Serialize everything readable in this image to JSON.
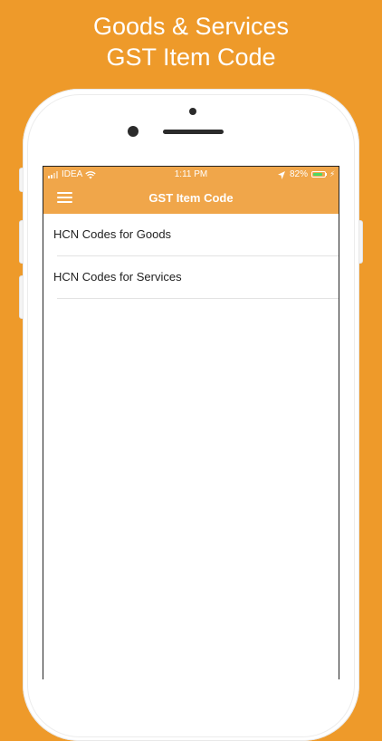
{
  "promo": {
    "line1": "Goods & Services",
    "line2": "GST Item Code"
  },
  "status_bar": {
    "carrier": "IDEA",
    "time": "1:11 PM",
    "battery_percent": "82%",
    "battery_level": 0.82
  },
  "nav": {
    "title": "GST Item Code",
    "menu_icon": "hamburger-menu-icon"
  },
  "items": [
    {
      "label": "HCN Codes for Goods"
    },
    {
      "label": "HCN Codes for Services"
    }
  ],
  "colors": {
    "background": "#EE9A2A",
    "bar": "#F0A64A",
    "battery": "#4CD964"
  }
}
